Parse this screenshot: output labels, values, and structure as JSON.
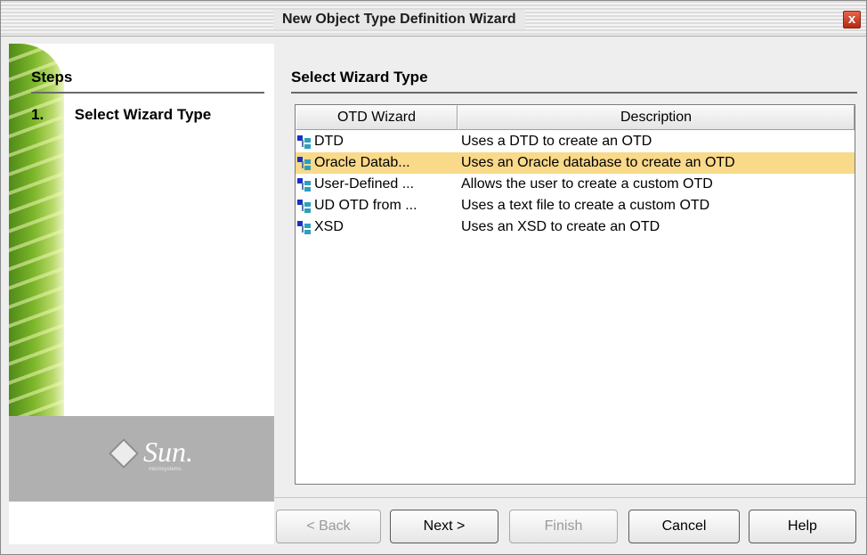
{
  "window": {
    "title": "New Object Type Definition Wizard",
    "close_label": "x"
  },
  "steps": {
    "heading": "Steps",
    "items": [
      {
        "number": "1.",
        "label": "Select Wizard Type"
      }
    ]
  },
  "brand": {
    "logo_text": "Sun.",
    "logo_subtext": "microsystems"
  },
  "main": {
    "heading": "Select Wizard Type",
    "table": {
      "columns": [
        "OTD Wizard",
        "Description"
      ],
      "rows": [
        {
          "name": "DTD",
          "description": "Uses a DTD to create an OTD",
          "selected": false
        },
        {
          "name": "Oracle Datab...",
          "description": "Uses an Oracle database to create an OTD",
          "selected": true
        },
        {
          "name": "User-Defined ...",
          "description": "Allows the user to create a custom OTD",
          "selected": false
        },
        {
          "name": "UD OTD from ...",
          "description": "Uses a text file to create a custom OTD",
          "selected": false
        },
        {
          "name": "XSD",
          "description": "Uses an XSD to create an OTD",
          "selected": false
        }
      ]
    }
  },
  "buttons": {
    "back": "< Back",
    "next": "Next >",
    "finish": "Finish",
    "cancel": "Cancel",
    "help": "Help"
  },
  "colors": {
    "selected_row": "#f9d98a",
    "leaf_green": "#7cb62a",
    "brand_strip": "#b0b0b0"
  },
  "icons": {
    "row_icon": "otd-tree-icon",
    "close": "close-icon",
    "logo": "sun-logo-icon"
  }
}
